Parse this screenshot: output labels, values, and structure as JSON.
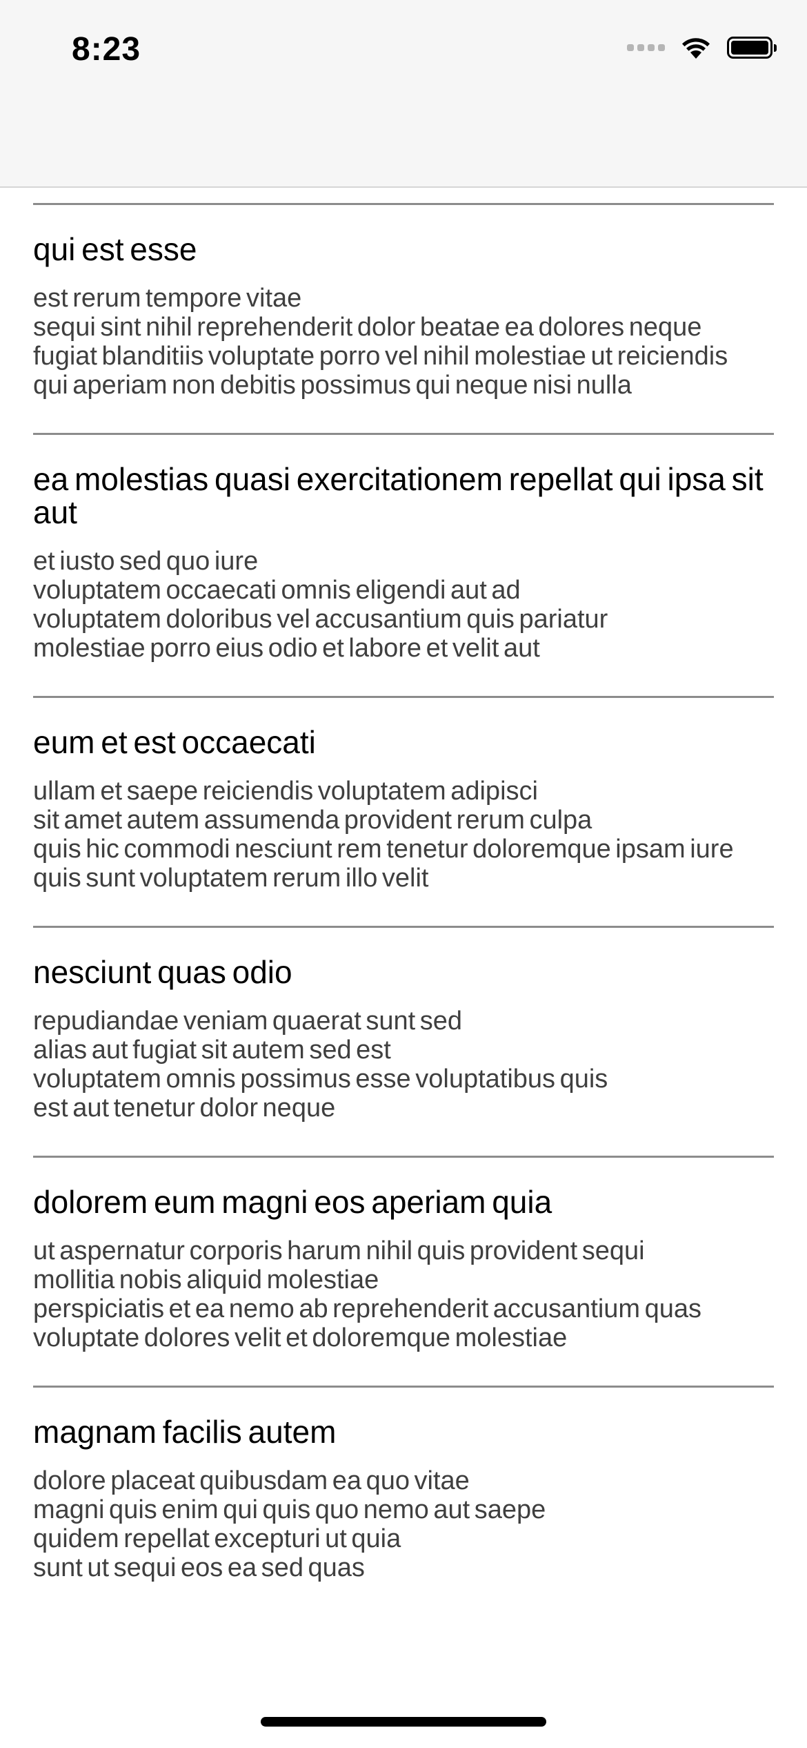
{
  "status_bar": {
    "time": "8:23",
    "signal_icon": "cellular-signal-icon",
    "wifi_icon": "wifi-icon",
    "battery_icon": "battery-full-icon"
  },
  "posts": [
    {
      "title": "qui est esse",
      "body": "est rerum tempore vitae\nsequi sint nihil reprehenderit dolor beatae ea dolores neque\nfugiat blanditiis voluptate porro vel nihil molestiae ut reiciendis\nqui aperiam non debitis possimus qui neque nisi nulla"
    },
    {
      "title": "ea molestias quasi exercitationem repellat qui ipsa sit aut",
      "body": "et iusto sed quo iure\nvoluptatem occaecati omnis eligendi aut ad\nvoluptatem doloribus vel accusantium quis pariatur\nmolestiae porro eius odio et labore et velit aut"
    },
    {
      "title": "eum et est occaecati",
      "body": "ullam et saepe reiciendis voluptatem adipisci\nsit amet autem assumenda provident rerum culpa\nquis hic commodi nesciunt rem tenetur doloremque ipsam iure\nquis sunt voluptatem rerum illo velit"
    },
    {
      "title": "nesciunt quas odio",
      "body": "repudiandae veniam quaerat sunt sed\nalias aut fugiat sit autem sed est\nvoluptatem omnis possimus esse voluptatibus quis\nest aut tenetur dolor neque"
    },
    {
      "title": "dolorem eum magni eos aperiam quia",
      "body": "ut aspernatur corporis harum nihil quis provident sequi\nmollitia nobis aliquid molestiae\nperspiciatis et ea nemo ab reprehenderit accusantium quas\nvoluptate dolores velit et doloremque molestiae"
    },
    {
      "title": "magnam facilis autem",
      "body": "dolore placeat quibusdam ea quo vitae\nmagni quis enim qui quis quo nemo aut saepe\nquidem repellat excepturi ut quia\nsunt ut sequi eos ea sed quas"
    }
  ]
}
